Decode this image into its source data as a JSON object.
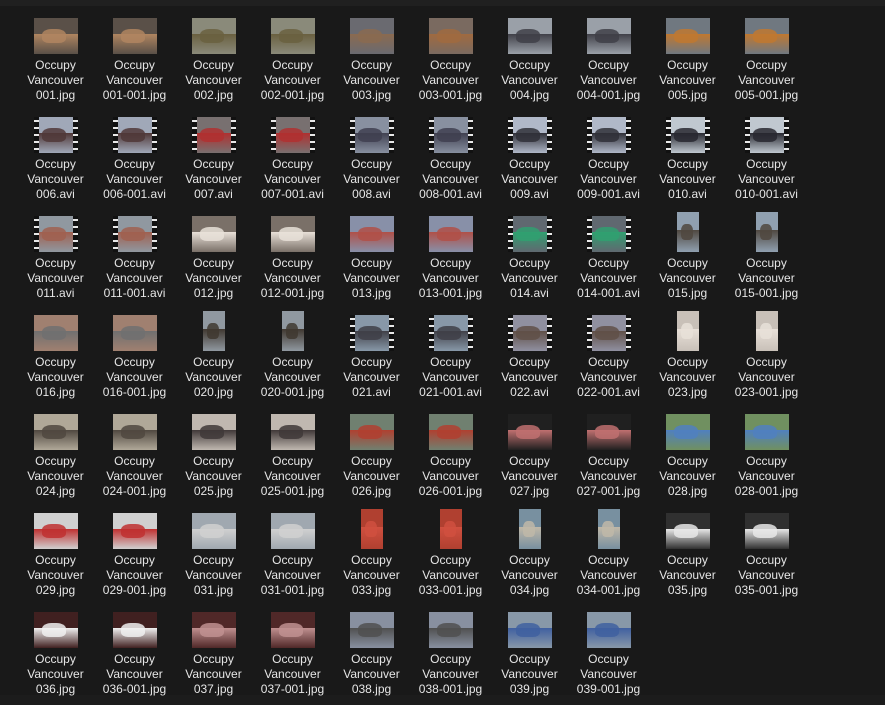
{
  "files": [
    {
      "l1": "Occupy",
      "l2": "Vancouver",
      "l3": "001.jpg",
      "type": "jpg",
      "tall": false,
      "c": [
        "#5a5048",
        "#b08560"
      ]
    },
    {
      "l1": "Occupy",
      "l2": "Vancouver",
      "l3": "001-001.jpg",
      "type": "jpg",
      "tall": false,
      "c": [
        "#5a5048",
        "#b08560"
      ]
    },
    {
      "l1": "Occupy",
      "l2": "Vancouver",
      "l3": "002.jpg",
      "type": "jpg",
      "tall": false,
      "c": [
        "#8a8a7a",
        "#6a6040"
      ]
    },
    {
      "l1": "Occupy",
      "l2": "Vancouver",
      "l3": "002-001.jpg",
      "type": "jpg",
      "tall": false,
      "c": [
        "#8a8a7a",
        "#6a6040"
      ]
    },
    {
      "l1": "Occupy",
      "l2": "Vancouver",
      "l3": "003.jpg",
      "type": "jpg",
      "tall": false,
      "c": [
        "#6a6a70",
        "#8a6a50"
      ]
    },
    {
      "l1": "Occupy",
      "l2": "Vancouver",
      "l3": "003-001.jpg",
      "type": "jpg",
      "tall": false,
      "c": [
        "#7a6a60",
        "#a06a40"
      ]
    },
    {
      "l1": "Occupy",
      "l2": "Vancouver",
      "l3": "004.jpg",
      "type": "jpg",
      "tall": false,
      "c": [
        "#9aa0a8",
        "#404048"
      ]
    },
    {
      "l1": "Occupy",
      "l2": "Vancouver",
      "l3": "004-001.jpg",
      "type": "jpg",
      "tall": false,
      "c": [
        "#9aa0a8",
        "#404048"
      ]
    },
    {
      "l1": "Occupy",
      "l2": "Vancouver",
      "l3": "005.jpg",
      "type": "jpg",
      "tall": false,
      "c": [
        "#707880",
        "#c07830"
      ]
    },
    {
      "l1": "Occupy",
      "l2": "Vancouver",
      "l3": "005-001.jpg",
      "type": "jpg",
      "tall": false,
      "c": [
        "#707880",
        "#c07830"
      ]
    },
    {
      "l1": "Occupy",
      "l2": "Vancouver",
      "l3": "006.avi",
      "type": "avi",
      "tall": false,
      "c": [
        "#a0a8b8",
        "#503838"
      ]
    },
    {
      "l1": "Occupy",
      "l2": "Vancouver",
      "l3": "006-001.avi",
      "type": "avi",
      "tall": false,
      "c": [
        "#a0a8b8",
        "#503838"
      ]
    },
    {
      "l1": "Occupy",
      "l2": "Vancouver",
      "l3": "007.avi",
      "type": "avi",
      "tall": false,
      "c": [
        "#787070",
        "#b03030"
      ]
    },
    {
      "l1": "Occupy",
      "l2": "Vancouver",
      "l3": "007-001.avi",
      "type": "avi",
      "tall": false,
      "c": [
        "#787070",
        "#b03030"
      ]
    },
    {
      "l1": "Occupy",
      "l2": "Vancouver",
      "l3": "008.avi",
      "type": "avi",
      "tall": false,
      "c": [
        "#8890a0",
        "#404050"
      ]
    },
    {
      "l1": "Occupy",
      "l2": "Vancouver",
      "l3": "008-001.avi",
      "type": "avi",
      "tall": false,
      "c": [
        "#8890a0",
        "#404050"
      ]
    },
    {
      "l1": "Occupy",
      "l2": "Vancouver",
      "l3": "009.avi",
      "type": "avi",
      "tall": false,
      "c": [
        "#b0b8c8",
        "#303038"
      ]
    },
    {
      "l1": "Occupy",
      "l2": "Vancouver",
      "l3": "009-001.avi",
      "type": "avi",
      "tall": false,
      "c": [
        "#b0b8c8",
        "#303038"
      ]
    },
    {
      "l1": "Occupy",
      "l2": "Vancouver",
      "l3": "010.avi",
      "type": "avi",
      "tall": false,
      "c": [
        "#c0c8d0",
        "#282830"
      ]
    },
    {
      "l1": "Occupy",
      "l2": "Vancouver",
      "l3": "010-001.avi",
      "type": "avi",
      "tall": false,
      "c": [
        "#c0c8d0",
        "#282830"
      ]
    },
    {
      "l1": "Occupy",
      "l2": "Vancouver",
      "l3": "011.avi",
      "type": "avi",
      "tall": false,
      "c": [
        "#9098a0",
        "#a06050"
      ]
    },
    {
      "l1": "Occupy",
      "l2": "Vancouver",
      "l3": "011-001.avi",
      "type": "avi",
      "tall": false,
      "c": [
        "#9098a0",
        "#a06050"
      ]
    },
    {
      "l1": "Occupy",
      "l2": "Vancouver",
      "l3": "012.jpg",
      "type": "jpg",
      "tall": false,
      "c": [
        "#7a7068",
        "#e8e0d8"
      ]
    },
    {
      "l1": "Occupy",
      "l2": "Vancouver",
      "l3": "012-001.jpg",
      "type": "jpg",
      "tall": false,
      "c": [
        "#7a7068",
        "#e8e0d8"
      ]
    },
    {
      "l1": "Occupy",
      "l2": "Vancouver",
      "l3": "013.jpg",
      "type": "jpg",
      "tall": false,
      "c": [
        "#8890a8",
        "#b05048"
      ]
    },
    {
      "l1": "Occupy",
      "l2": "Vancouver",
      "l3": "013-001.jpg",
      "type": "jpg",
      "tall": false,
      "c": [
        "#8890a8",
        "#b05048"
      ]
    },
    {
      "l1": "Occupy",
      "l2": "Vancouver",
      "l3": "014.avi",
      "type": "avi",
      "tall": false,
      "c": [
        "#606870",
        "#30a070"
      ]
    },
    {
      "l1": "Occupy",
      "l2": "Vancouver",
      "l3": "014-001.avi",
      "type": "avi",
      "tall": false,
      "c": [
        "#606870",
        "#30a070"
      ]
    },
    {
      "l1": "Occupy",
      "l2": "Vancouver",
      "l3": "015.jpg",
      "type": "jpg",
      "tall": true,
      "c": [
        "#90a0b0",
        "#504840"
      ]
    },
    {
      "l1": "Occupy",
      "l2": "Vancouver",
      "l3": "015-001.jpg",
      "type": "jpg",
      "tall": true,
      "c": [
        "#90a0b0",
        "#504840"
      ]
    },
    {
      "l1": "Occupy",
      "l2": "Vancouver",
      "l3": "016.jpg",
      "type": "jpg",
      "tall": false,
      "c": [
        "#a08070",
        "#707070"
      ]
    },
    {
      "l1": "Occupy",
      "l2": "Vancouver",
      "l3": "016-001.jpg",
      "type": "jpg",
      "tall": false,
      "c": [
        "#a08070",
        "#707070"
      ]
    },
    {
      "l1": "Occupy",
      "l2": "Vancouver",
      "l3": "020.jpg",
      "type": "jpg",
      "tall": true,
      "c": [
        "#9098a0",
        "#403830"
      ]
    },
    {
      "l1": "Occupy",
      "l2": "Vancouver",
      "l3": "020-001.jpg",
      "type": "jpg",
      "tall": true,
      "c": [
        "#9098a0",
        "#403830"
      ]
    },
    {
      "l1": "Occupy",
      "l2": "Vancouver",
      "l3": "021.avi",
      "type": "avi",
      "tall": false,
      "c": [
        "#8898a8",
        "#404048"
      ]
    },
    {
      "l1": "Occupy",
      "l2": "Vancouver",
      "l3": "021-001.avi",
      "type": "avi",
      "tall": false,
      "c": [
        "#8898a8",
        "#404048"
      ]
    },
    {
      "l1": "Occupy",
      "l2": "Vancouver",
      "l3": "022.avi",
      "type": "avi",
      "tall": false,
      "c": [
        "#9090a0",
        "#605048"
      ]
    },
    {
      "l1": "Occupy",
      "l2": "Vancouver",
      "l3": "022-001.avi",
      "type": "avi",
      "tall": false,
      "c": [
        "#9090a0",
        "#605048"
      ]
    },
    {
      "l1": "Occupy",
      "l2": "Vancouver",
      "l3": "023.jpg",
      "type": "jpg",
      "tall": true,
      "c": [
        "#c8c0b8",
        "#e8e0d8"
      ]
    },
    {
      "l1": "Occupy",
      "l2": "Vancouver",
      "l3": "023-001.jpg",
      "type": "jpg",
      "tall": true,
      "c": [
        "#c8c0b8",
        "#e8e0d8"
      ]
    },
    {
      "l1": "Occupy",
      "l2": "Vancouver",
      "l3": "024.jpg",
      "type": "jpg",
      "tall": false,
      "c": [
        "#b0a898",
        "#504840"
      ]
    },
    {
      "l1": "Occupy",
      "l2": "Vancouver",
      "l3": "024-001.jpg",
      "type": "jpg",
      "tall": false,
      "c": [
        "#b0a898",
        "#504840"
      ]
    },
    {
      "l1": "Occupy",
      "l2": "Vancouver",
      "l3": "025.jpg",
      "type": "jpg",
      "tall": false,
      "c": [
        "#c0b8b0",
        "#403838"
      ]
    },
    {
      "l1": "Occupy",
      "l2": "Vancouver",
      "l3": "025-001.jpg",
      "type": "jpg",
      "tall": false,
      "c": [
        "#c0b8b0",
        "#403838"
      ]
    },
    {
      "l1": "Occupy",
      "l2": "Vancouver",
      "l3": "026.jpg",
      "type": "jpg",
      "tall": false,
      "c": [
        "#708070",
        "#b04030"
      ]
    },
    {
      "l1": "Occupy",
      "l2": "Vancouver",
      "l3": "026-001.jpg",
      "type": "jpg",
      "tall": false,
      "c": [
        "#708070",
        "#b04030"
      ]
    },
    {
      "l1": "Occupy",
      "l2": "Vancouver",
      "l3": "027.jpg",
      "type": "jpg",
      "tall": false,
      "c": [
        "#202020",
        "#c07070"
      ]
    },
    {
      "l1": "Occupy",
      "l2": "Vancouver",
      "l3": "027-001.jpg",
      "type": "jpg",
      "tall": false,
      "c": [
        "#202020",
        "#c07070"
      ]
    },
    {
      "l1": "Occupy",
      "l2": "Vancouver",
      "l3": "028.jpg",
      "type": "jpg",
      "tall": false,
      "c": [
        "#709060",
        "#5080c0"
      ]
    },
    {
      "l1": "Occupy",
      "l2": "Vancouver",
      "l3": "028-001.jpg",
      "type": "jpg",
      "tall": false,
      "c": [
        "#709060",
        "#5080c0"
      ]
    },
    {
      "l1": "Occupy",
      "l2": "Vancouver",
      "l3": "029.jpg",
      "type": "jpg",
      "tall": false,
      "c": [
        "#d0d0d0",
        "#c03030"
      ]
    },
    {
      "l1": "Occupy",
      "l2": "Vancouver",
      "l3": "029-001.jpg",
      "type": "jpg",
      "tall": false,
      "c": [
        "#d0d0d0",
        "#c03030"
      ]
    },
    {
      "l1": "Occupy",
      "l2": "Vancouver",
      "l3": "031.jpg",
      "type": "jpg",
      "tall": false,
      "c": [
        "#a0a8b0",
        "#d0d0d0"
      ]
    },
    {
      "l1": "Occupy",
      "l2": "Vancouver",
      "l3": "031-001.jpg",
      "type": "jpg",
      "tall": false,
      "c": [
        "#a0a8b0",
        "#d0d0d0"
      ]
    },
    {
      "l1": "Occupy",
      "l2": "Vancouver",
      "l3": "033.jpg",
      "type": "jpg",
      "tall": true,
      "c": [
        "#b04030",
        "#d05040"
      ]
    },
    {
      "l1": "Occupy",
      "l2": "Vancouver",
      "l3": "033-001.jpg",
      "type": "jpg",
      "tall": true,
      "c": [
        "#b04030",
        "#d05040"
      ]
    },
    {
      "l1": "Occupy",
      "l2": "Vancouver",
      "l3": "034.jpg",
      "type": "jpg",
      "tall": true,
      "c": [
        "#7890a0",
        "#c0b8a8"
      ]
    },
    {
      "l1": "Occupy",
      "l2": "Vancouver",
      "l3": "034-001.jpg",
      "type": "jpg",
      "tall": true,
      "c": [
        "#7890a0",
        "#c0b8a8"
      ]
    },
    {
      "l1": "Occupy",
      "l2": "Vancouver",
      "l3": "035.jpg",
      "type": "jpg",
      "tall": false,
      "c": [
        "#303030",
        "#e8e8e8"
      ]
    },
    {
      "l1": "Occupy",
      "l2": "Vancouver",
      "l3": "035-001.jpg",
      "type": "jpg",
      "tall": false,
      "c": [
        "#303030",
        "#e8e8e8"
      ]
    },
    {
      "l1": "Occupy",
      "l2": "Vancouver",
      "l3": "036.jpg",
      "type": "jpg",
      "tall": false,
      "c": [
        "#402020",
        "#f0f0f0"
      ]
    },
    {
      "l1": "Occupy",
      "l2": "Vancouver",
      "l3": "036-001.jpg",
      "type": "jpg",
      "tall": false,
      "c": [
        "#402020",
        "#f0f0f0"
      ]
    },
    {
      "l1": "Occupy",
      "l2": "Vancouver",
      "l3": "037.jpg",
      "type": "jpg",
      "tall": false,
      "c": [
        "#502828",
        "#c09090"
      ]
    },
    {
      "l1": "Occupy",
      "l2": "Vancouver",
      "l3": "037-001.jpg",
      "type": "jpg",
      "tall": false,
      "c": [
        "#502828",
        "#c09090"
      ]
    },
    {
      "l1": "Occupy",
      "l2": "Vancouver",
      "l3": "038.jpg",
      "type": "jpg",
      "tall": false,
      "c": [
        "#8890a0",
        "#505050"
      ]
    },
    {
      "l1": "Occupy",
      "l2": "Vancouver",
      "l3": "038-001.jpg",
      "type": "jpg",
      "tall": false,
      "c": [
        "#8890a0",
        "#505050"
      ]
    },
    {
      "l1": "Occupy",
      "l2": "Vancouver",
      "l3": "039.jpg",
      "type": "jpg",
      "tall": false,
      "c": [
        "#8898a8",
        "#4060a0"
      ]
    },
    {
      "l1": "Occupy",
      "l2": "Vancouver",
      "l3": "039-001.jpg",
      "type": "jpg",
      "tall": false,
      "c": [
        "#8898a8",
        "#4060a0"
      ]
    }
  ]
}
